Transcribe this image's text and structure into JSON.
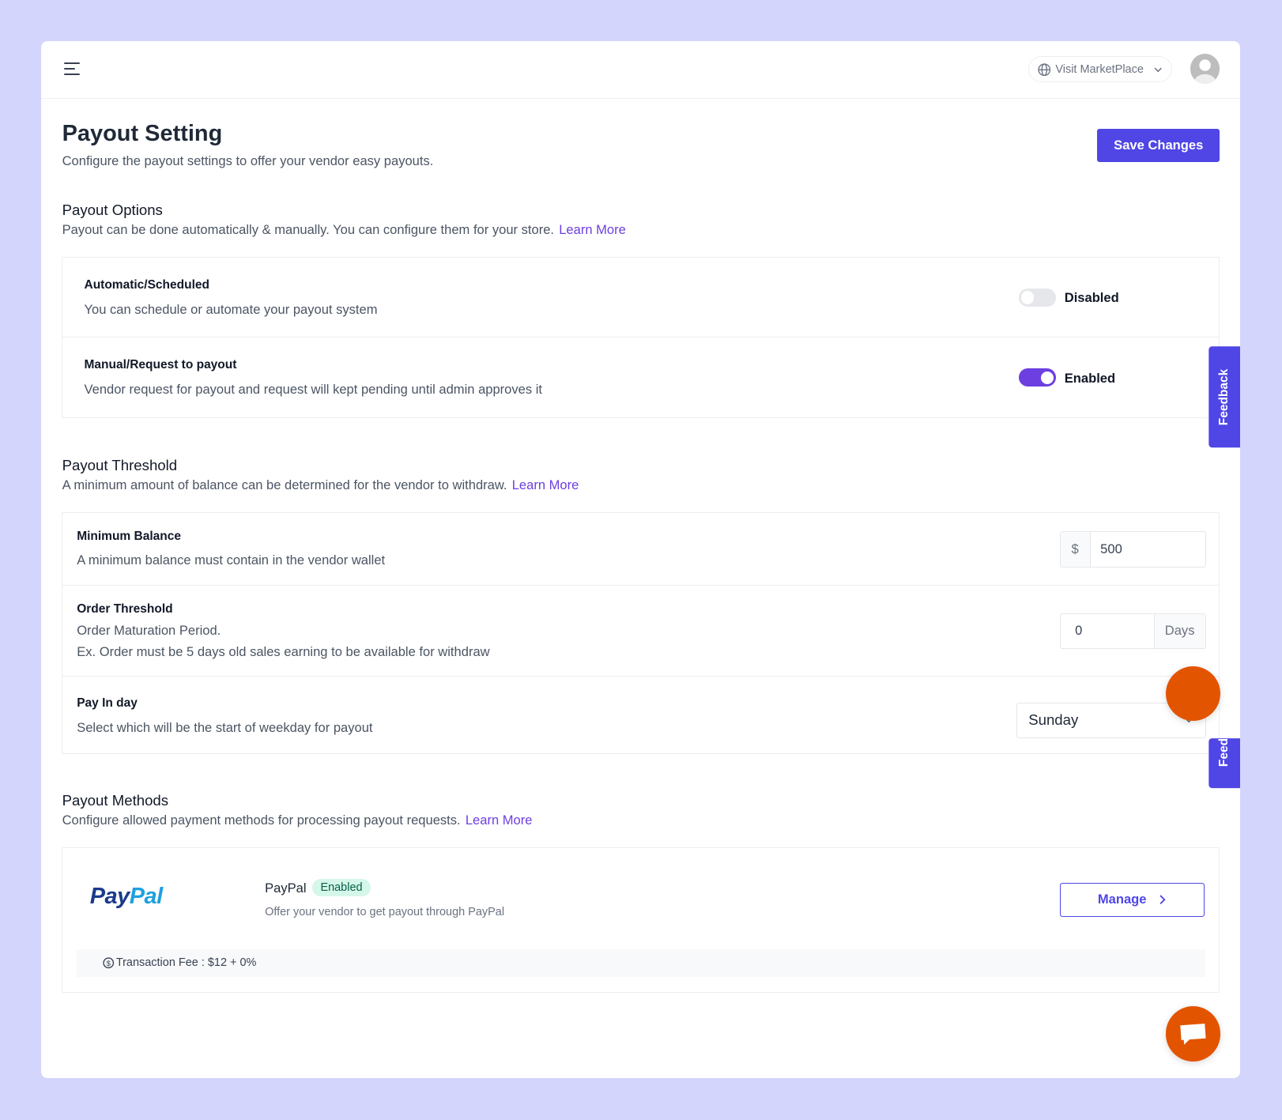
{
  "header": {
    "visit_label": "Visit MarketPlace"
  },
  "page": {
    "title": "Payout Setting",
    "subtitle": "Configure the payout settings to offer your vendor easy payouts.",
    "save_label": "Save Changes"
  },
  "options": {
    "title": "Payout Options",
    "desc": "Payout can be done automatically & manually. You can configure them for your store.",
    "learn": "Learn More",
    "items": [
      {
        "title": "Automatic/Scheduled",
        "desc": "You can schedule or automate your payout system",
        "enabled": false,
        "state": "Disabled"
      },
      {
        "title": "Manual/Request to payout",
        "desc": "Vendor request for payout and request will kept pending until admin approves it",
        "enabled": true,
        "state": "Enabled"
      }
    ]
  },
  "threshold": {
    "title": "Payout Threshold",
    "desc": "A minimum amount of balance can be determined for the vendor to withdraw.",
    "learn": "Learn More",
    "min": {
      "title": "Minimum Balance",
      "desc": "A minimum balance must contain in the vendor wallet",
      "prefix": "$",
      "value": "500"
    },
    "order": {
      "title": "Order Threshold",
      "desc1": "Order Maturation Period.",
      "desc2": "Ex. Order must be 5 days old sales earning to be available for withdraw",
      "value": "0",
      "suffix": "Days"
    },
    "payin": {
      "title": "Pay In day",
      "desc": "Select which will be the start of weekday for payout",
      "value": "Sunday"
    }
  },
  "methods": {
    "title": "Payout Methods",
    "desc": "Configure allowed payment methods for processing payout requests.",
    "learn": "Learn More",
    "paypal": {
      "logo": "PayPal",
      "name": "PayPal",
      "badge": "Enabled",
      "desc": "Offer your vendor to get payout through PayPal",
      "manage": "Manage",
      "fee": "Transaction Fee : $12 + 0%"
    }
  },
  "feedback": {
    "label": "Feedback",
    "label_partial": "Feed"
  },
  "colors": {
    "accent": "#4f46e5",
    "link": "#6d3fe0",
    "fab": "#e35400",
    "badge_bg": "#d5f7ea"
  }
}
